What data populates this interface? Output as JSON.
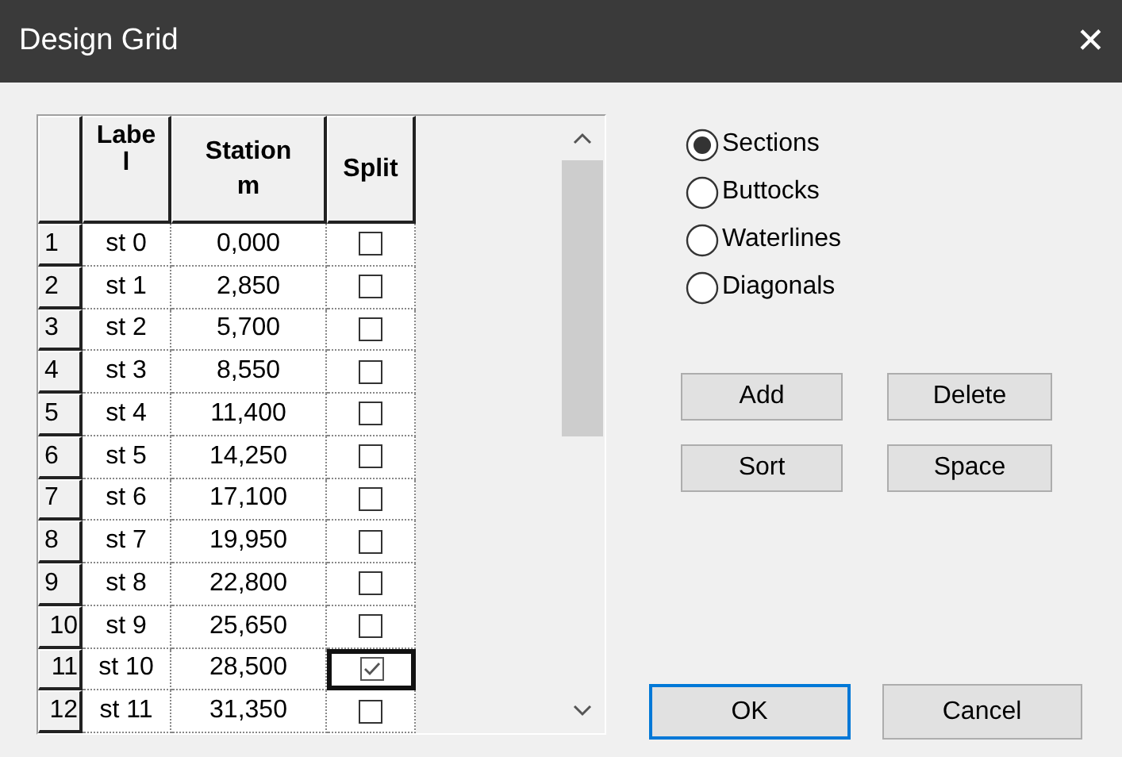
{
  "window": {
    "title": "Design Grid",
    "close": "✕"
  },
  "grid": {
    "columns": [
      "Label",
      "Station m",
      "Split"
    ],
    "rows": [
      {
        "number": "1",
        "label": "st 0",
        "station": "0,000",
        "split": false,
        "focused": false
      },
      {
        "number": "2",
        "label": "st 1",
        "station": "2,850",
        "split": false,
        "focused": false
      },
      {
        "number": "3",
        "label": "st 2",
        "station": "5,700",
        "split": false,
        "focused": false
      },
      {
        "number": "4",
        "label": "st 3",
        "station": "8,550",
        "split": false,
        "focused": false
      },
      {
        "number": "5",
        "label": "st 4",
        "station": "11,400",
        "split": false,
        "focused": false
      },
      {
        "number": "6",
        "label": "st 5",
        "station": "14,250",
        "split": false,
        "focused": false
      },
      {
        "number": "7",
        "label": "st 6",
        "station": "17,100",
        "split": false,
        "focused": false
      },
      {
        "number": "8",
        "label": "st 7",
        "station": "19,950",
        "split": false,
        "focused": false
      },
      {
        "number": "9",
        "label": "st 8",
        "station": "22,800",
        "split": false,
        "focused": false
      },
      {
        "number": "10",
        "label": "st 9",
        "station": "25,650",
        "split": false,
        "focused": false
      },
      {
        "number": "11",
        "label": "st 10",
        "station": "28,500",
        "split": true,
        "focused": true
      },
      {
        "number": "12",
        "label": "st 11",
        "station": "31,350",
        "split": false,
        "focused": false
      }
    ]
  },
  "options": [
    {
      "label": "Sections",
      "selected": true
    },
    {
      "label": "Buttocks",
      "selected": false
    },
    {
      "label": "Waterlines",
      "selected": false
    },
    {
      "label": "Diagonals",
      "selected": false
    }
  ],
  "actions": [
    "Add",
    "Delete",
    "Sort",
    "Space"
  ],
  "buttons": [
    {
      "label": "OK",
      "default": true
    },
    {
      "label": "Cancel",
      "default": false
    }
  ]
}
